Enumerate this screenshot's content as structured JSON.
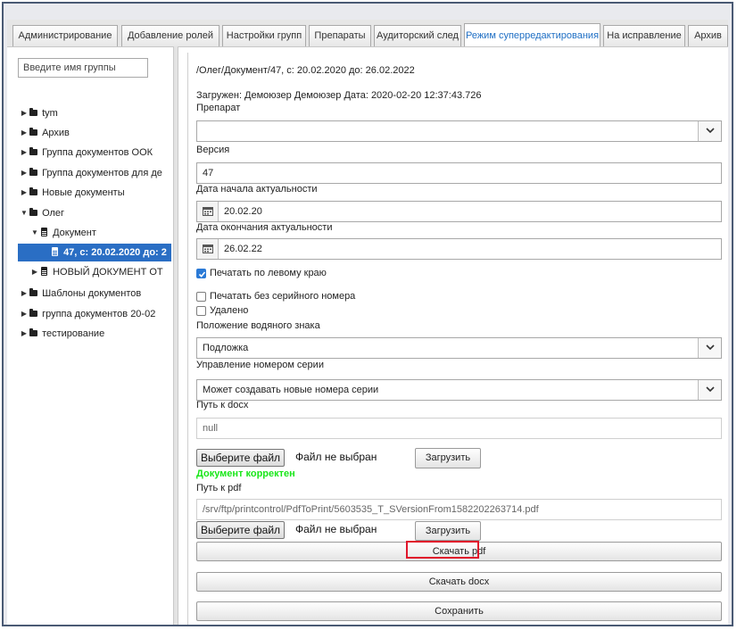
{
  "tabs": [
    {
      "label": "Администрирование"
    },
    {
      "label": "Добавление ролей"
    },
    {
      "label": "Настройки групп"
    },
    {
      "label": "Препараты"
    },
    {
      "label": "Аудиторский след"
    },
    {
      "label": "Режим суперредактирования"
    },
    {
      "label": "На исправление"
    },
    {
      "label": "Архив"
    }
  ],
  "sidebar": {
    "search_placeholder": "Введите имя группы",
    "tree": [
      {
        "label": "tym"
      },
      {
        "label": "Архив"
      },
      {
        "label": "Группа документов ООК"
      },
      {
        "label": "Группа документов для де"
      },
      {
        "label": "Новые документы"
      },
      {
        "label": "Олег"
      },
      {
        "label": "Документ"
      },
      {
        "label": "47, с: 20.02.2020 до: 2"
      },
      {
        "label": "НОВЫЙ ДОКУМЕНТ ОТ"
      },
      {
        "label": "Шаблоны документов"
      },
      {
        "label": "группа документов 20-02"
      },
      {
        "label": "тестирование"
      }
    ]
  },
  "document": {
    "path": "/Олег/Документ/47, с: 20.02.2020 до: 26.02.2022",
    "loaded_info": "Загружен: Демоюзер Демоюзер Дата: 2020-02-20 12:37:43.726",
    "drug_label": "Препарат",
    "drug_value": "",
    "version_label": "Версия",
    "version_value": "47",
    "start_label": "Дата начала актуальности",
    "start_value": "20.02.20",
    "end_label": "Дата окончания актуальности",
    "end_value": "26.02.22",
    "print_left_label": "Печатать по левому краю",
    "print_left_checked": true,
    "print_no_serial_label": "Печатать без серийного номера",
    "deleted_label": "Удалено",
    "watermark_label": "Положение водяного знака",
    "watermark_value": "Подложка",
    "serial_label": "Управление номером серии",
    "serial_value": "Может создавать новые номера серии",
    "docx_path_label": "Путь к docx",
    "docx_path_value": "null",
    "choose_file_label": "Выберите файл",
    "no_file_label": "Файл не выбран",
    "upload_label": "Загрузить",
    "doc_ok_message": "Документ корректен",
    "pdf_path_label": "Путь к pdf",
    "pdf_path_value": "/srv/ftp/printcontrol/PdfToPrint/5603535_T_SVersionFrom1582202263714.pdf",
    "download_pdf_label": "Скачать pdf",
    "download_docx_label": "Скачать docx",
    "save_label": "Сохранить"
  },
  "colors": {
    "active_tab_text": "#1f6fc4",
    "selected_node_bg": "#2a6ec4",
    "ok_message": "#19e619",
    "highlight_border": "#e0162b"
  }
}
